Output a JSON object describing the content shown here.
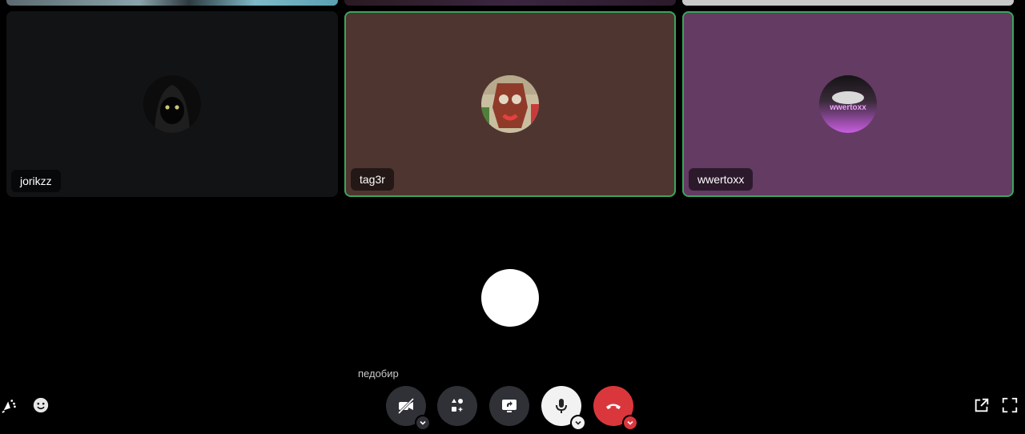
{
  "participants": [
    {
      "name": "jorikzz",
      "tile_color": "#111315",
      "speaking": false,
      "avatar_icon": "black-cat-hood-avatar"
    },
    {
      "name": "tag3r",
      "tile_color": "#4f3530",
      "speaking": true,
      "avatar_icon": "art-avatar"
    },
    {
      "name": "wwertoxx",
      "tile_color": "#633b63",
      "speaking": true,
      "avatar_icon": "logo-avatar"
    }
  ],
  "avatar_logo_text": "wwertoxx",
  "focused": {
    "caption": "педобир"
  },
  "controls": {
    "camera": "camera-off-icon",
    "activities": "activities-icon",
    "screenshare": "screen-share-icon",
    "mic": "microphone-icon",
    "leave": "phone-hangup-icon"
  },
  "colors": {
    "speaking": "#3ba55c",
    "danger": "#da373c",
    "button": "#2f3136"
  }
}
